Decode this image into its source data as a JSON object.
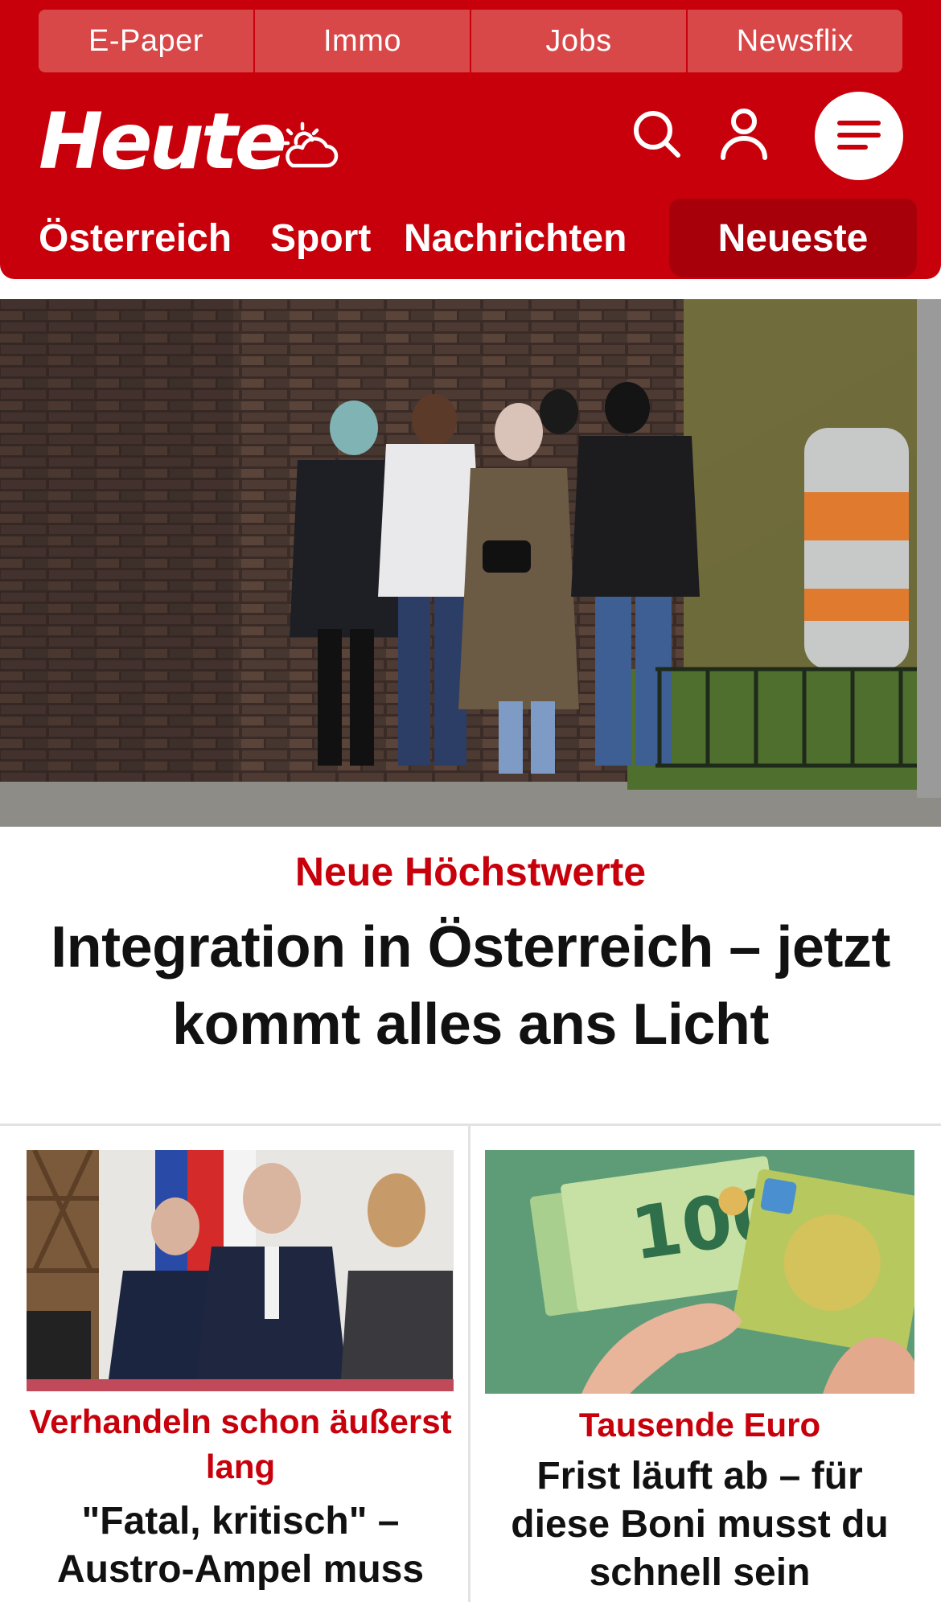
{
  "topnav": {
    "items": [
      {
        "label": "E-Paper"
      },
      {
        "label": "Immo"
      },
      {
        "label": "Jobs"
      },
      {
        "label": "Newsflix"
      }
    ]
  },
  "header": {
    "logo_text": "Heute",
    "brand_color": "#c8000b",
    "icons": [
      "weather-partly-cloudy-icon",
      "search-icon",
      "user-icon",
      "menu-icon"
    ]
  },
  "secnav": {
    "items": [
      {
        "label": "Österreich"
      },
      {
        "label": "Sport"
      },
      {
        "label": "Nachrichten"
      }
    ],
    "active": {
      "label": "Neueste"
    }
  },
  "hero": {
    "kicker": "Neue Höchstwerte",
    "title": "Integration in Österreich – jetzt kommt alles ans Licht"
  },
  "articles": [
    {
      "kicker": "Verhandeln schon äußerst lang",
      "title": "\"Fatal, kritisch\" – Austro-Ampel muss"
    },
    {
      "kicker": "Tausende Euro",
      "title": "Frist läuft ab – für diese Boni musst du schnell sein"
    }
  ]
}
